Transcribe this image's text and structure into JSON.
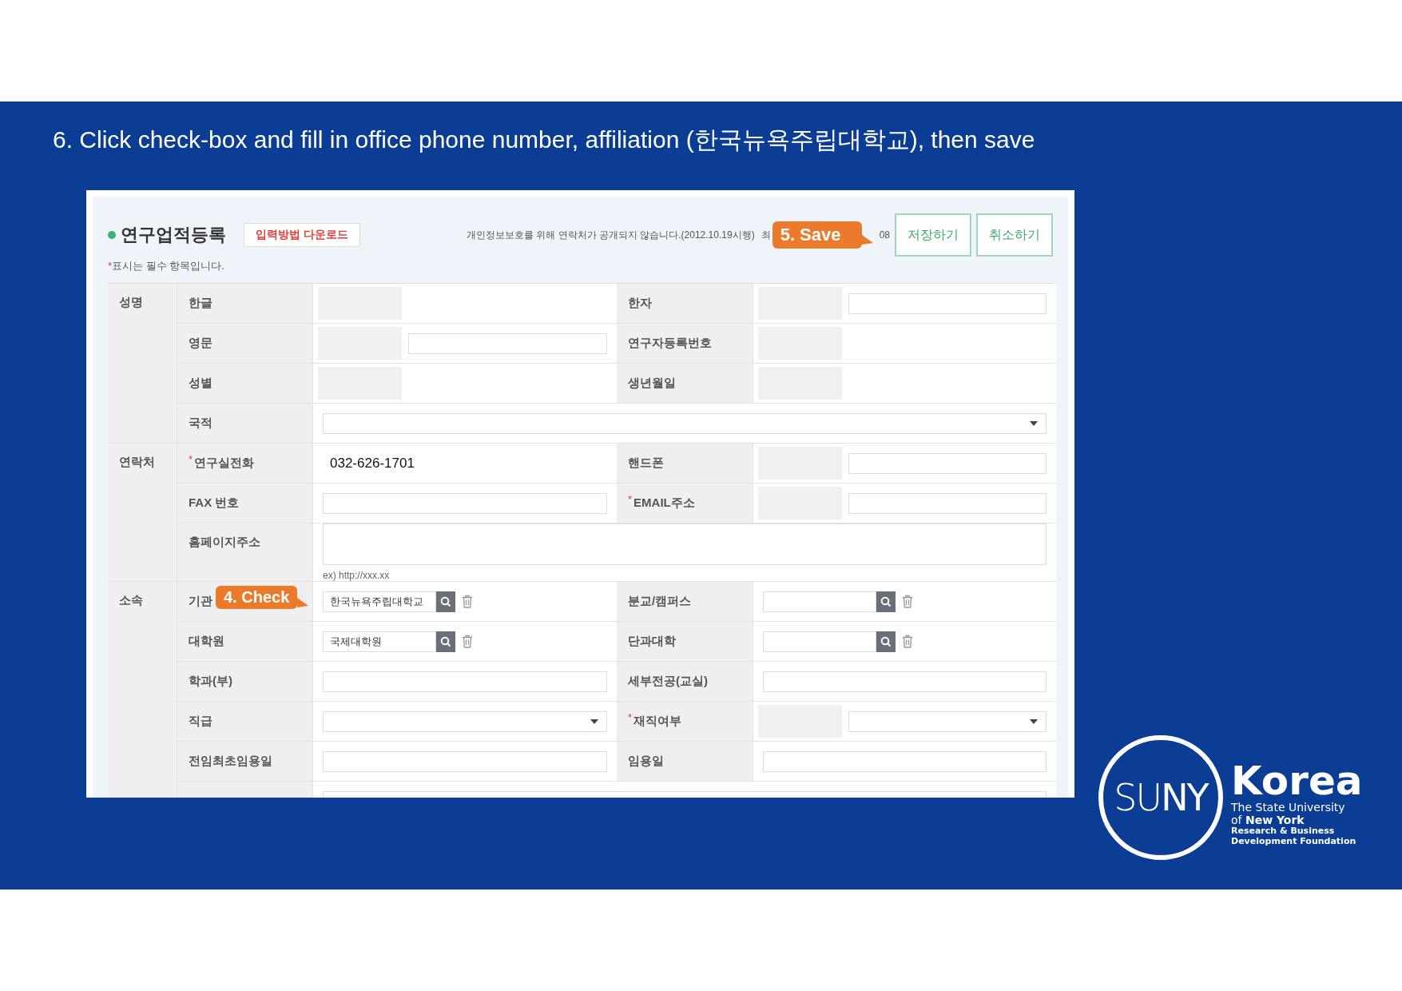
{
  "slide_title": "6. Click check-box and fill in office phone number, affiliation (한국뉴욕주립대학교), then save",
  "form": {
    "title": "연구업적등록",
    "download_button": "입력방법 다운로드",
    "notice": "개인정보보호를 위해 연락처가 공개되지 않습니다.(2012.10.19시행)",
    "notice_cut_start": "최",
    "notice_cut_end": "08",
    "save_callout": "5. Save",
    "buttons": [
      {
        "label": "저장하기"
      },
      {
        "label": "취소하기"
      }
    ],
    "required_note": {
      "mark": "*",
      "text": "표시는 필수 항목입니다."
    },
    "sections": [
      {
        "group": "성명",
        "rows": [
          {
            "fields": [
              {
                "label": "한글",
                "kind": "blank",
                "redacted": true
              },
              {
                "label": "한자",
                "kind": "text",
                "redacted": true
              }
            ]
          },
          {
            "fields": [
              {
                "label": "영문",
                "kind": "text",
                "redacted": true
              },
              {
                "label": "연구자등록번호",
                "kind": "blank",
                "redacted": true
              }
            ]
          },
          {
            "fields": [
              {
                "label": "성별",
                "kind": "blank",
                "redacted": true
              },
              {
                "label": "생년월일",
                "kind": "blank",
                "redacted": true
              }
            ]
          },
          {
            "fields": [
              {
                "label": "국적",
                "kind": "select"
              }
            ]
          }
        ]
      },
      {
        "group": "연락처",
        "rows": [
          {
            "fields": [
              {
                "label": "연구실전화",
                "mark": "*",
                "kind": "text",
                "value": "032-626-1701"
              },
              {
                "label": "핸드폰",
                "kind": "text",
                "redacted": true
              }
            ]
          },
          {
            "fields": [
              {
                "label": "FAX 번호",
                "kind": "text"
              },
              {
                "label": "EMAIL주소",
                "mark": "*",
                "kind": "text",
                "redacted": true
              }
            ]
          },
          {
            "fields": [
              {
                "label": "홈페이지주소",
                "kind": "url",
                "hint": "ex) http://xxx.xx"
              }
            ]
          }
        ]
      },
      {
        "group": "소속",
        "rows": [
          {
            "fields": [
              {
                "label": "기관",
                "callout": "4. Check",
                "kind": "search",
                "value": "한국뉴욕주립대학교"
              },
              {
                "label": "분교/캠퍼스",
                "kind": "search"
              }
            ]
          },
          {
            "fields": [
              {
                "label": "대학원",
                "kind": "search",
                "value": "국제대학원"
              },
              {
                "label": "단과대학",
                "kind": "search"
              }
            ]
          },
          {
            "fields": [
              {
                "label": "학과(부)",
                "kind": "text"
              },
              {
                "label": "세부전공(교실)",
                "kind": "text"
              }
            ]
          },
          {
            "fields": [
              {
                "label": "직급",
                "kind": "select"
              },
              {
                "label": "재직여부",
                "mark": "*",
                "kind": "select",
                "redacted": true
              }
            ]
          },
          {
            "fields": [
              {
                "label": "전임최초임용일",
                "kind": "text"
              },
              {
                "label": "임용일",
                "kind": "text"
              }
            ]
          },
          {
            "fields": [
              {
                "kind": "text"
              }
            ]
          }
        ]
      }
    ]
  },
  "logo": {
    "mark": "SU**NY**",
    "name": "Korea",
    "lines": [
      "The State University",
      "of **New York**",
      "Research & Business",
      "Development Foundation"
    ]
  }
}
